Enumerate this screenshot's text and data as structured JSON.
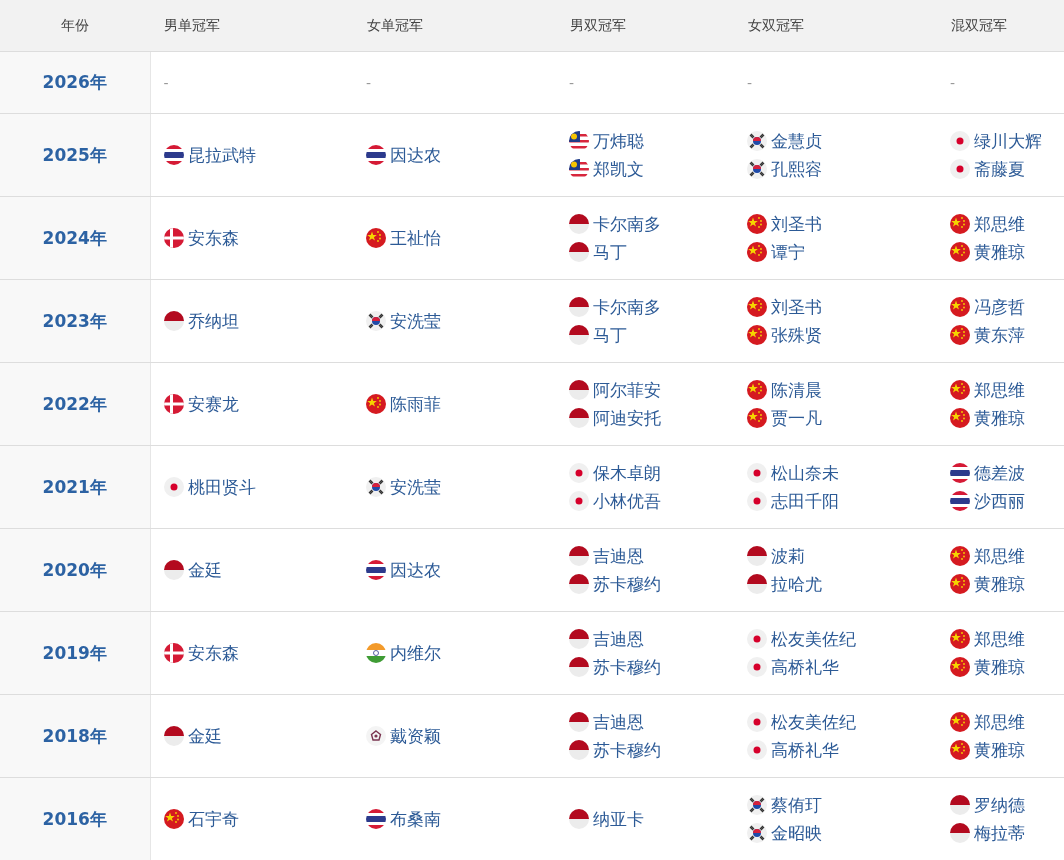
{
  "columns": [
    "年份",
    "男单冠军",
    "女单冠军",
    "男双冠军",
    "女双冠军",
    "混双冠军"
  ],
  "rows": [
    {
      "year": "2026年",
      "cells": [
        [
          {
            "name": "-"
          }
        ],
        [
          {
            "name": "-"
          }
        ],
        [
          {
            "name": "-"
          }
        ],
        [
          {
            "name": "-"
          }
        ],
        [
          {
            "name": "-"
          }
        ]
      ]
    },
    {
      "year": "2025年",
      "cells": [
        [
          {
            "kind": "th",
            "name": "昆拉武特"
          }
        ],
        [
          {
            "kind": "th",
            "name": "因达农"
          }
        ],
        [
          {
            "kind": "my",
            "name": "万炜聪"
          },
          {
            "kind": "my",
            "name": "郑凯文"
          }
        ],
        [
          {
            "kind": "kr",
            "name": "金慧贞"
          },
          {
            "kind": "kr",
            "name": "孔熙容"
          }
        ],
        [
          {
            "kind": "jp",
            "name": "绿川大辉"
          },
          {
            "kind": "jp",
            "name": "斋藤夏"
          }
        ]
      ]
    },
    {
      "year": "2024年",
      "cells": [
        [
          {
            "kind": "dk",
            "name": "安东森"
          }
        ],
        [
          {
            "kind": "cn",
            "name": "王祉怡"
          }
        ],
        [
          {
            "kind": "id",
            "name": "卡尔南多"
          },
          {
            "kind": "id",
            "name": "马丁"
          }
        ],
        [
          {
            "kind": "cn",
            "name": "刘圣书"
          },
          {
            "kind": "cn",
            "name": "谭宁"
          }
        ],
        [
          {
            "kind": "cn",
            "name": "郑思维"
          },
          {
            "kind": "cn",
            "name": "黄雅琼"
          }
        ]
      ]
    },
    {
      "year": "2023年",
      "cells": [
        [
          {
            "kind": "id",
            "name": "乔纳坦"
          }
        ],
        [
          {
            "kind": "kr",
            "name": "安洗莹"
          }
        ],
        [
          {
            "kind": "id",
            "name": "卡尔南多"
          },
          {
            "kind": "id",
            "name": "马丁"
          }
        ],
        [
          {
            "kind": "cn",
            "name": "刘圣书"
          },
          {
            "kind": "cn",
            "name": "张殊贤"
          }
        ],
        [
          {
            "kind": "cn",
            "name": "冯彦哲"
          },
          {
            "kind": "cn",
            "name": "黄东萍"
          }
        ]
      ]
    },
    {
      "year": "2022年",
      "cells": [
        [
          {
            "kind": "dk",
            "name": "安赛龙"
          }
        ],
        [
          {
            "kind": "cn",
            "name": "陈雨菲"
          }
        ],
        [
          {
            "kind": "id",
            "name": "阿尔菲安"
          },
          {
            "kind": "id",
            "name": "阿迪安托"
          }
        ],
        [
          {
            "kind": "cn",
            "name": "陈清晨"
          },
          {
            "kind": "cn",
            "name": "贾一凡"
          }
        ],
        [
          {
            "kind": "cn",
            "name": "郑思维"
          },
          {
            "kind": "cn",
            "name": "黄雅琼"
          }
        ]
      ]
    },
    {
      "year": "2021年",
      "cells": [
        [
          {
            "kind": "jp",
            "name": "桃田贤斗"
          }
        ],
        [
          {
            "kind": "kr",
            "name": "安洗莹"
          }
        ],
        [
          {
            "kind": "jp",
            "name": "保木卓朗"
          },
          {
            "kind": "jp",
            "name": "小林优吾"
          }
        ],
        [
          {
            "kind": "jp",
            "name": "松山奈未"
          },
          {
            "kind": "jp",
            "name": "志田千阳"
          }
        ],
        [
          {
            "kind": "th",
            "name": "德差波"
          },
          {
            "kind": "th",
            "name": "沙西丽"
          }
        ]
      ]
    },
    {
      "year": "2020年",
      "cells": [
        [
          {
            "kind": "id",
            "name": "金廷"
          }
        ],
        [
          {
            "kind": "th",
            "name": "因达农"
          }
        ],
        [
          {
            "kind": "id",
            "name": "吉迪恩"
          },
          {
            "kind": "id",
            "name": "苏卡穆约"
          }
        ],
        [
          {
            "kind": "id",
            "name": "波莉"
          },
          {
            "kind": "id",
            "name": "拉哈尤"
          }
        ],
        [
          {
            "kind": "cn",
            "name": "郑思维"
          },
          {
            "kind": "cn",
            "name": "黄雅琼"
          }
        ]
      ]
    },
    {
      "year": "2019年",
      "cells": [
        [
          {
            "kind": "dk",
            "name": "安东森"
          }
        ],
        [
          {
            "kind": "in",
            "name": "内维尔"
          }
        ],
        [
          {
            "kind": "id",
            "name": "吉迪恩"
          },
          {
            "kind": "id",
            "name": "苏卡穆约"
          }
        ],
        [
          {
            "kind": "jp",
            "name": "松友美佐纪"
          },
          {
            "kind": "jp",
            "name": "高桥礼华"
          }
        ],
        [
          {
            "kind": "cn",
            "name": "郑思维"
          },
          {
            "kind": "cn",
            "name": "黄雅琼"
          }
        ]
      ]
    },
    {
      "year": "2018年",
      "cells": [
        [
          {
            "kind": "id",
            "name": "金廷"
          }
        ],
        [
          {
            "kind": "tpe",
            "name": "戴资颖"
          }
        ],
        [
          {
            "kind": "id",
            "name": "吉迪恩"
          },
          {
            "kind": "id",
            "name": "苏卡穆约"
          }
        ],
        [
          {
            "kind": "jp",
            "name": "松友美佐纪"
          },
          {
            "kind": "jp",
            "name": "高桥礼华"
          }
        ],
        [
          {
            "kind": "cn",
            "name": "郑思维"
          },
          {
            "kind": "cn",
            "name": "黄雅琼"
          }
        ]
      ]
    },
    {
      "year": "2016年",
      "cells": [
        [
          {
            "kind": "cn",
            "name": "石宇奇"
          }
        ],
        [
          {
            "kind": "th",
            "name": "布桑南"
          }
        ],
        [
          {
            "kind": "id",
            "name": "纳亚卡"
          }
        ],
        [
          {
            "kind": "kr",
            "name": "蔡侑玎"
          },
          {
            "kind": "kr",
            "name": "金昭映"
          }
        ],
        [
          {
            "kind": "id",
            "name": "罗纳德"
          },
          {
            "kind": "id",
            "name": "梅拉蒂"
          }
        ]
      ]
    }
  ]
}
